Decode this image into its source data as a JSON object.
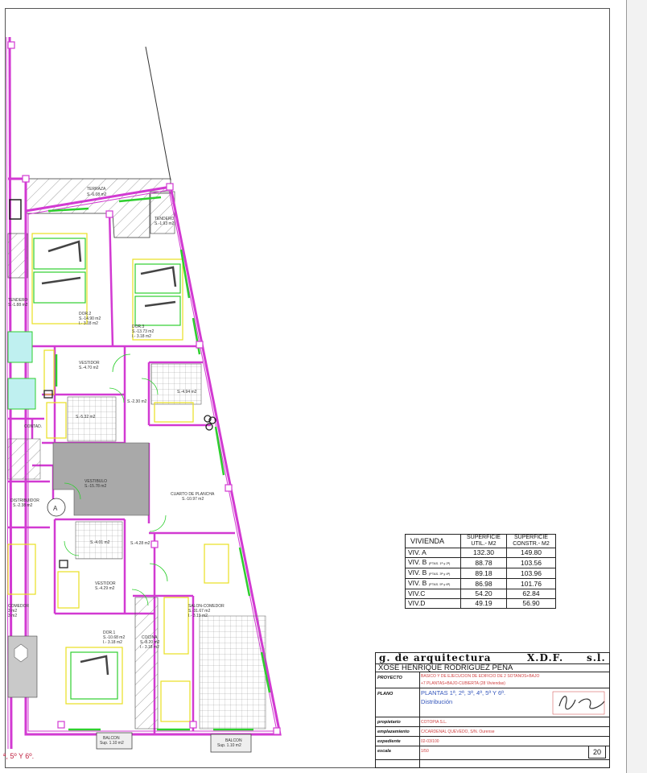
{
  "rooms": {
    "terraza": "TERRAZA",
    "terraza_area": "S.-6.08 m2",
    "tendero": "TENDERO",
    "tendero_area": "S.-1.93 m2",
    "tendero_left": "TENDERO",
    "tendero_left_area": "S.-1.88 m2",
    "dor2": "DOR.2",
    "dor2_area": "S.-14.90 m2",
    "dor2_h": "I.- 3.18 m2",
    "dor3": "DOR.3",
    "dor3_area": "S.-13.73 m2",
    "dor3_h": "I.- 3.18 m2",
    "vestidor1": "VESTIDOR",
    "vestidor1_area": "S.-4.70 m2",
    "bano1_area": "S.-5.32 m2",
    "bano2_area": "S.-4.94 m2",
    "distrib_area": "S.-2.30 m2",
    "contad": "CONTAD.",
    "vestibulo": "VESTIBULO",
    "vestibulo_area": "S.-15.78 m2",
    "cuarto_plancha": "CUARTO DE PLANCHA",
    "cuarto_plancha_area": "S.-10.97 m2",
    "distribuidor": "DISTRIBUIDOR",
    "distribuidor_area": "S.-2.38 m2",
    "unit_a": "A",
    "bano3_area": "S.-4.01 m2",
    "pasillo_area": "S.-4.28 m2",
    "vestidor2": "VESTIDOR",
    "vestidor2_area": "S.-4.29 m2",
    "salon": "SALON-COMEDOR",
    "salon_area": "S.-31.67 m2",
    "salon_h": "I.- 3.19 m2",
    "comedor_left": "COMEDOR",
    "comedor_left_area": "3 m2",
    "comedor_left_h": "3 m2",
    "dor1": "DOR.1",
    "dor1_area": "S.-10.68 m2",
    "dor1_h": "I.- 3.18 m2",
    "cocina": "COCINA",
    "cocina_area": "S.-8.20 m2",
    "cocina_h": "I.- 3.18 m2",
    "balcon1": "BALCON",
    "balcon1_area": "Sup. 1.10 m2",
    "balcon2": "BALCON",
    "balcon2_area": "Sup. 1.10 m2",
    "floor_caption": "ª, 5º Y 6º."
  },
  "area_table": {
    "col1": "VIVIENDA",
    "col2a": "SUPERFICIE",
    "col2b": "UTIL.- M2",
    "col3a": "SUPERFICIE",
    "col3b": "CONSTR.- M2",
    "rows": [
      {
        "name": "VIV. A",
        "note": "",
        "util": "132.30",
        "constr": "149.80"
      },
      {
        "name": "VIV. B",
        "note": "(PTAS. 1ª y 2ª)",
        "util": "88.78",
        "constr": "103.56"
      },
      {
        "name": "VIV. B",
        "note": "(PTAS. 3ª y 4ª)",
        "util": "89.18",
        "constr": "103.96"
      },
      {
        "name": "VIV. B",
        "note": "(PTAS. 5ª y 6ª)",
        "util": "86.98",
        "constr": "101.76"
      },
      {
        "name": "VIV.C",
        "note": "",
        "util": "54.20",
        "constr": "62.84"
      },
      {
        "name": "VIV.D",
        "note": "",
        "util": "49.19",
        "constr": "56.90"
      }
    ]
  },
  "title_block": {
    "firm_1": "g. de arquitectura",
    "firm_2": "X.D.F.",
    "firm_3": "s.l.",
    "architect": "XOSE HENRIQUE RODRIGUEZ PEÑA",
    "proyecto_label": "PROYECTO",
    "proyecto_line1": "BASICO Y DE EJECUCION DE EDIFICIO DE 2 SOTANOS+BAJO",
    "proyecto_line2": "+7 PLANTAS+BAJO-CUBIERTA (28 Viviendas)",
    "plano_label": "PLANO",
    "plano_line1": "PLANTAS 1ª, 2ª, 3ª, 4ª, 5ª Y 6ª.",
    "plano_line2": "Distribución",
    "propietario_label": "propietario",
    "propietario": "COTOPIA S.L.",
    "emplazamiento_label": "emplazamiento",
    "emplazamiento": "C/CARDENAL QUEVEDO, S/N. Ourense",
    "expediente_label": "expediente",
    "expediente": "02-03/100",
    "escala_label": "escala",
    "escala": "1/50",
    "sheet_number": "20"
  },
  "colors": {
    "wall_magenta": "#d23ad2",
    "green": "#2ecf2e",
    "yellow": "#e8e020",
    "hatch": "#888888",
    "gray_fill": "#a9a9a9",
    "blue": "#3355bb",
    "red": "#d04040"
  }
}
